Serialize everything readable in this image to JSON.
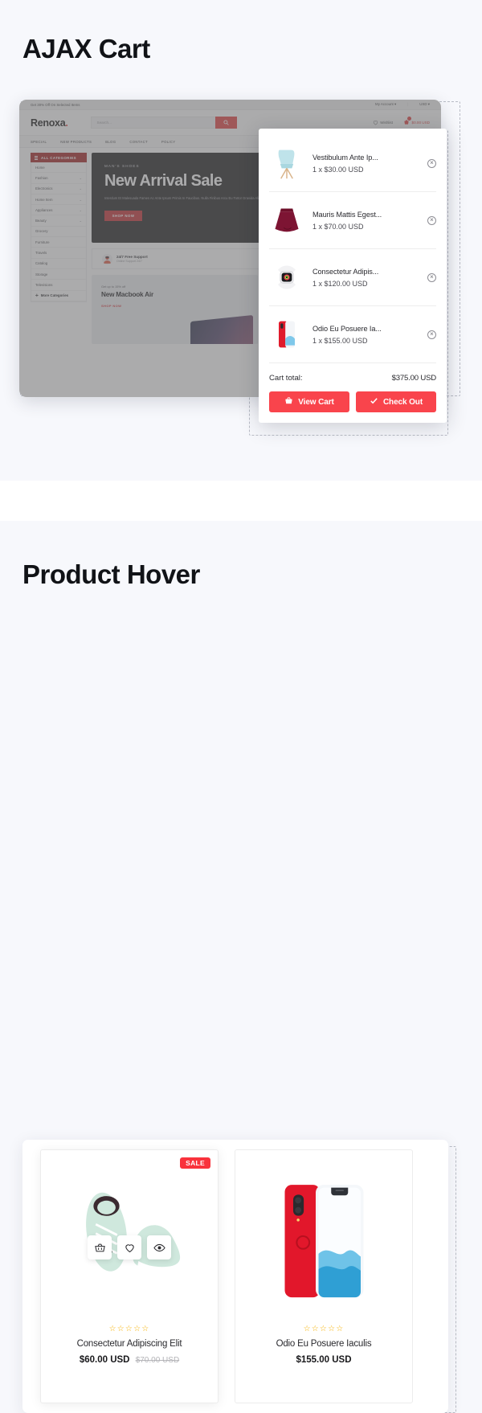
{
  "sections": {
    "ajax": {
      "title": "AJAX Cart"
    },
    "hover": {
      "title": "Product Hover"
    }
  },
  "browser": {
    "topbar": {
      "promo": "Get 30% Off On Selected Items",
      "account": "My Account ▾",
      "currency": "USD ▾"
    },
    "header": {
      "logo": "Renoxa",
      "logo_dot": ".",
      "search_placeholder": "Search...",
      "search_icon": "search-icon",
      "wishlist_label": "Wishlist",
      "wishlist_icon": "heart-icon",
      "cart_icon": "cart-icon",
      "cart_amount": "$0.00 USD"
    },
    "nav": [
      "SPECIAL",
      "NEW PRODUCTS",
      "BLOG",
      "CONTACT",
      "POLICY"
    ],
    "sidebar": {
      "header": "ALL CATEGORIES",
      "items": [
        {
          "label": "Home",
          "caret": ""
        },
        {
          "label": "Fashion",
          "caret": "⌄"
        },
        {
          "label": "Electronics",
          "caret": "⌄"
        },
        {
          "label": "Home Item",
          "caret": "⌄"
        },
        {
          "label": "Appliances",
          "caret": "⌄"
        },
        {
          "label": "Beauty",
          "caret": "⌄"
        },
        {
          "label": "Grocery",
          "caret": ""
        },
        {
          "label": "Furniture",
          "caret": ""
        },
        {
          "label": "Travels",
          "caret": ""
        },
        {
          "label": "Catalog",
          "caret": ""
        },
        {
          "label": "Storage",
          "caret": ""
        },
        {
          "label": "Televisions",
          "caret": ""
        }
      ],
      "more": "More Categories"
    },
    "hero": {
      "kicker": "MAN'S SHOES",
      "title": "New Arrival Sale",
      "body": "Interdum Et Malesuada Fames Ac Ante Ipsum Primis In Faucibus. Nulla Finibus Arcu Eu Tortor Gravida Aliquet",
      "button": "SHOP NOW"
    },
    "features": [
      {
        "title": "24/7 Free Support",
        "subtitle": "Online Support 24/7"
      }
    ],
    "promos": [
      {
        "kicker": "Get up to 15% off",
        "title": "New Macbook Air",
        "link": "SHOP NOW"
      }
    ]
  },
  "cart": {
    "items": [
      {
        "name": "Vestibulum Ante Ip...",
        "qty": "1 x $30.00 USD",
        "thumb": "chair-thumb",
        "close_icon": "close-icon"
      },
      {
        "name": "Mauris Mattis Egest...",
        "qty": "1 x $70.00 USD",
        "thumb": "skirt-thumb",
        "close_icon": "close-icon"
      },
      {
        "name": "Consectetur Adipis...",
        "qty": "1 x $120.00 USD",
        "thumb": "watch-thumb",
        "close_icon": "close-icon"
      },
      {
        "name": "Odio Eu Posuere Ia...",
        "qty": "1 x $155.00 USD",
        "thumb": "phone-thumb",
        "close_icon": "close-icon"
      }
    ],
    "total_label": "Cart total:",
    "total_value": "$375.00 USD",
    "view_cart": "View Cart",
    "checkout": "Check Out"
  },
  "products": [
    {
      "badge": "SALE",
      "stars": "☆☆☆☆☆",
      "name": "Consectetur Adipiscing Elit",
      "price": "$60.00 USD",
      "old_price": "$70.00 USD",
      "image": "sneakers-image",
      "actions": [
        {
          "icon": "basket-icon"
        },
        {
          "icon": "heart-icon"
        },
        {
          "icon": "eye-icon"
        }
      ]
    },
    {
      "badge": "",
      "stars": "☆☆☆☆☆",
      "name": "Odio Eu Posuere Iaculis",
      "price": "$155.00 USD",
      "old_price": "",
      "image": "phone-image",
      "actions": []
    }
  ],
  "colors": {
    "accent_red": "#f9444c",
    "dark_red": "#a01c1c",
    "star_gold": "#f6b100",
    "page_bg": "#f7f8fc"
  }
}
